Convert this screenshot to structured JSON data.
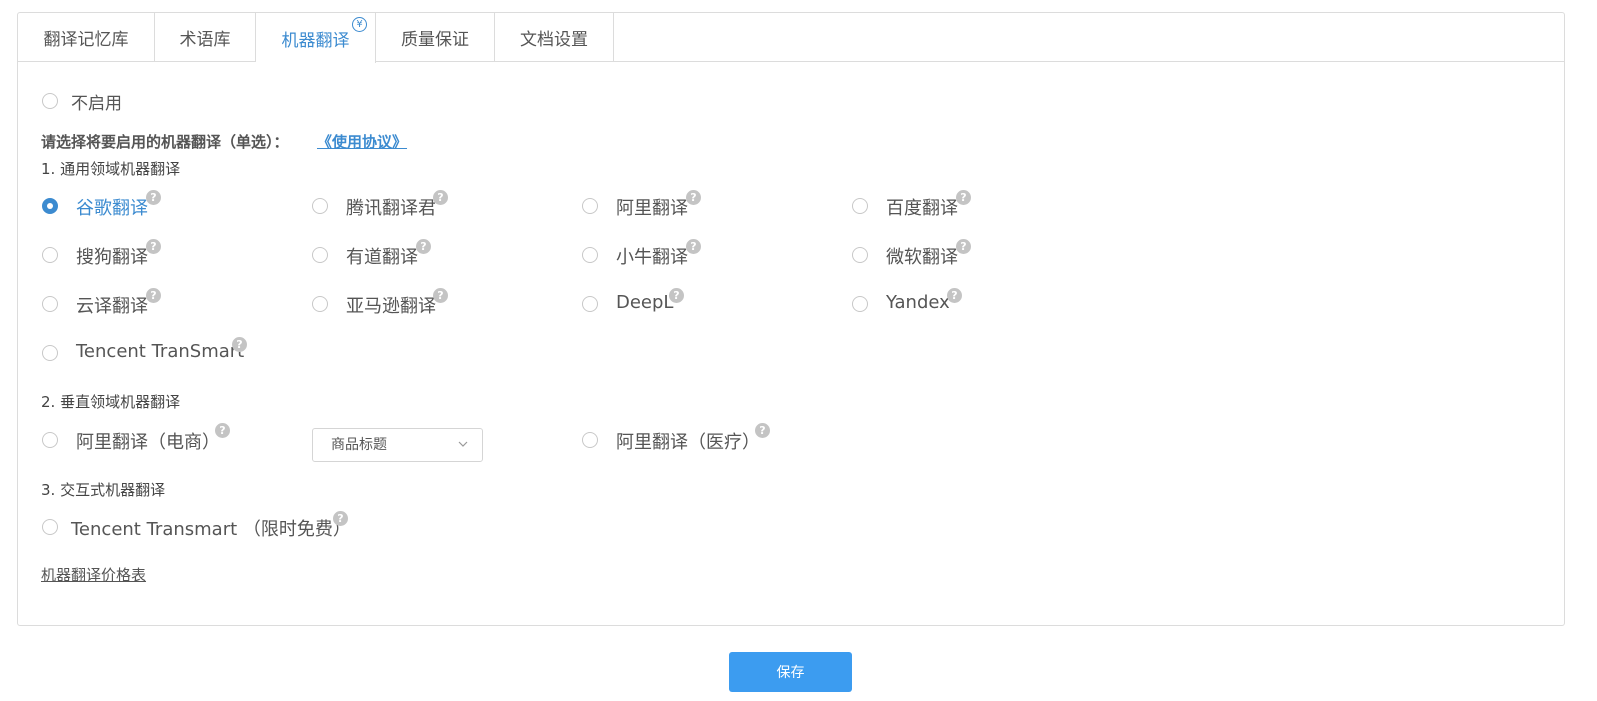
{
  "tabs": [
    {
      "label": "翻译记忆库"
    },
    {
      "label": "术语库"
    },
    {
      "label": "机器翻译",
      "badge": "¥"
    },
    {
      "label": "质量保证"
    },
    {
      "label": "文档设置"
    }
  ],
  "disable_option": {
    "label": "不启用"
  },
  "prompt": {
    "text": "请选择将要启用的机器翻译（单选）：",
    "agreement_link": "《使用协议》"
  },
  "sections": {
    "general": "1. 通用领域机器翻译",
    "vertical": "2. 垂直领域机器翻译",
    "interactive": "3. 交互式机器翻译"
  },
  "general_options": [
    {
      "label": "谷歌翻译",
      "selected": true
    },
    {
      "label": "腾讯翻译君"
    },
    {
      "label": "阿里翻译"
    },
    {
      "label": "百度翻译"
    },
    {
      "label": "搜狗翻译"
    },
    {
      "label": "有道翻译"
    },
    {
      "label": "小牛翻译"
    },
    {
      "label": "微软翻译"
    },
    {
      "label": "云译翻译"
    },
    {
      "label": "亚马逊翻译"
    },
    {
      "label": "DeepL"
    },
    {
      "label": "Yandex"
    },
    {
      "label": "Tencent TranSmart"
    }
  ],
  "vertical_options": [
    {
      "label": "阿里翻译（电商）"
    },
    {
      "label": "阿里翻译（医疗）"
    }
  ],
  "vertical_select": {
    "value": "商品标题"
  },
  "interactive_options": [
    {
      "label": "Tencent Transmart （限时免费）"
    }
  ],
  "help_glyph": "?",
  "price_link": "机器翻译价格表",
  "save_button": "保存",
  "colors": {
    "accent": "#3c8bd0",
    "button": "#3c9cf0",
    "help": "#c4c4c4"
  }
}
